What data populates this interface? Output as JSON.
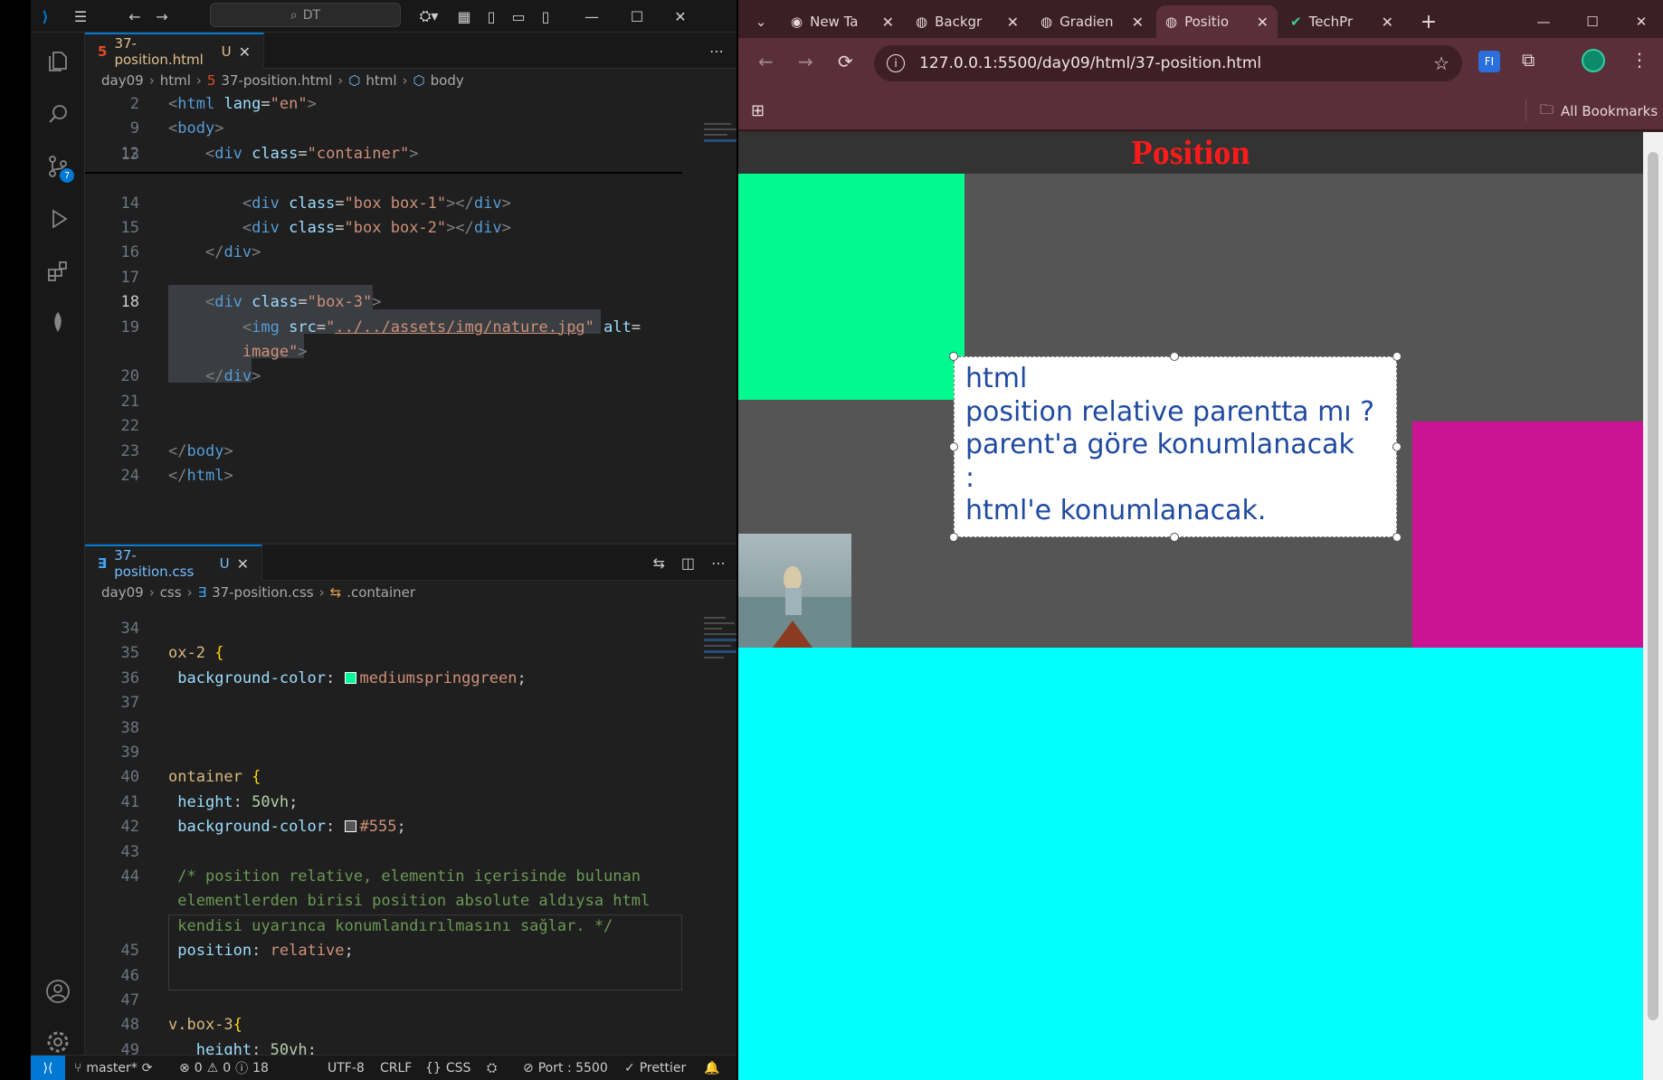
{
  "vscode": {
    "command_center": "DT",
    "editor1": {
      "tab_label": "37-position.html",
      "tab_status": "U",
      "breadcrumb": [
        "day09",
        "html",
        "37-position.html",
        "html",
        "body"
      ],
      "lines": [
        {
          "n": "2",
          "html": "<span class='t'>&lt;</span><span class='tg'>html</span> <span class='at'>lang</span>=<span class='st'>\"en\"</span><span class='t'>&gt;</span>"
        },
        {
          "n": "9",
          "html": "<span class='t'>&lt;</span><span class='tg'>body</span><span class='t'>&gt;</span>"
        },
        {
          "n": "12",
          "html": "    <span class='t'>&lt;</span><span class='tg'>div</span> <span class='at'>class</span>=<span class='st'>\"container\"</span><span class='t'>&gt;</span>"
        },
        {
          "n": "13",
          "html": ""
        },
        {
          "n": "14",
          "html": "        <span class='t'>&lt;</span><span class='tg'>div</span> <span class='at'>class</span>=<span class='st'>\"box box-1\"</span><span class='t'>&gt;&lt;/</span><span class='tg'>div</span><span class='t'>&gt;</span>"
        },
        {
          "n": "15",
          "html": "        <span class='t'>&lt;</span><span class='tg'>div</span> <span class='at'>class</span>=<span class='st'>\"box box-2\"</span><span class='t'>&gt;&lt;/</span><span class='tg'>div</span><span class='t'>&gt;</span>"
        },
        {
          "n": "16",
          "html": "    <span class='t'>&lt;/</span><span class='tg'>div</span><span class='t'>&gt;</span>"
        },
        {
          "n": "17",
          "html": ""
        },
        {
          "n": "18",
          "html": "    <span class='t'>&lt;</span><span class='tg'>div</span> <span class='at'>class</span>=<span class='st'>\"box-3\"</span><span class='t'>&gt;</span>"
        },
        {
          "n": "19",
          "html": "        <span class='t'>&lt;</span><span class='tg'>img</span> <span class='at'>src</span>=<span class='st'>\"<u>../../assets/img/nature.jpg</u>\"</span> <span class='at'>alt</span>="
        },
        {
          "n": "",
          "html": "        <span class='st'>image\"</span><span class='t'>&gt;</span>"
        },
        {
          "n": "20",
          "html": "    <span class='t'>&lt;/</span><span class='tg'>div</span><span class='t'>&gt;</span>"
        },
        {
          "n": "21",
          "html": ""
        },
        {
          "n": "22",
          "html": ""
        },
        {
          "n": "23",
          "html": "<span class='t'>&lt;/</span><span class='tg'>body</span><span class='t'>&gt;</span>"
        },
        {
          "n": "24",
          "html": "<span class='t'>&lt;/</span><span class='tg'>html</span><span class='t'>&gt;</span>"
        }
      ]
    },
    "editor2": {
      "tab_label": "37-position.css",
      "tab_status": "U",
      "breadcrumb": [
        "day09",
        "css",
        "37-position.css",
        ".container"
      ],
      "lines": [
        {
          "n": "34",
          "html": ""
        },
        {
          "n": "35",
          "html": "<span class='sel'>ox-2</span> <span class='br'>{</span>"
        },
        {
          "n": "36",
          "html": " <span class='pr'>background-color</span>: <span class='swatch' style='background:#00fa9a'></span><span class='vl'>mediumspringgreen</span>;"
        },
        {
          "n": "37",
          "html": ""
        },
        {
          "n": "38",
          "html": ""
        },
        {
          "n": "39",
          "html": ""
        },
        {
          "n": "40",
          "html": "<span class='sel'>ontainer</span> <span class='br'>{</span>"
        },
        {
          "n": "41",
          "html": " <span class='pr'>height</span>: <span class='nm'>50vh</span>;"
        },
        {
          "n": "42",
          "html": " <span class='pr'>background-color</span>: <span class='swatch' style='background:#555'></span><span class='vl'>#555</span>;"
        },
        {
          "n": "43",
          "html": ""
        },
        {
          "n": "44",
          "html": " <span class='cm'>/* position relative, elementin içerisinde bulunan</span>"
        },
        {
          "n": "",
          "html": " <span class='cm'>elementlerden birisi position absolute aldıysa html</span>"
        },
        {
          "n": "",
          "html": " <span class='cm'>kendisi uyarınca konumlandırılmasını sağlar. */</span>"
        },
        {
          "n": "45",
          "html": " <span class='pr'>position</span>: <span class='vl'>relative</span>;"
        },
        {
          "n": "46",
          "html": ""
        },
        {
          "n": "47",
          "html": ""
        },
        {
          "n": "48",
          "html": "<span class='sel'>v.box-3</span><span class='br'>{</span>"
        },
        {
          "n": "49",
          "html": "   <span class='pr'>height</span>: <span class='nm'>50vh</span>;"
        }
      ]
    },
    "status": {
      "branch": "master*",
      "errors": "0",
      "warnings": "0",
      "info": "18",
      "encoding": "UTF-8",
      "eol": "CRLF",
      "language": "CSS",
      "port": "Port : 5500",
      "formatter": "Prettier"
    }
  },
  "browser": {
    "tabs": [
      {
        "label": "New Ta",
        "icon": "chrome-icon",
        "active": false
      },
      {
        "label": "Backgr",
        "icon": "globe-icon",
        "active": false
      },
      {
        "label": "Gradien",
        "icon": "globe-icon",
        "active": false
      },
      {
        "label": "Positio",
        "icon": "globe-icon",
        "active": true
      },
      {
        "label": "TechPr",
        "icon": "check-icon",
        "active": false
      }
    ],
    "url": "127.0.0.1:5500/day09/html/37-position.html",
    "bookmarks_label": "All Bookmarks",
    "page": {
      "heading": "Position",
      "note_lines": [
        "html",
        "position relative parentta mı ?",
        "parent'a göre konumlanacak",
        ":",
        "html'e konumlanacak."
      ]
    }
  },
  "colors": {
    "heading": "#ff1a1a",
    "box1": "#00fa8f",
    "box2": "#cc1493",
    "body_bg": "#00ffff",
    "note_text": "#1f4aa0"
  }
}
